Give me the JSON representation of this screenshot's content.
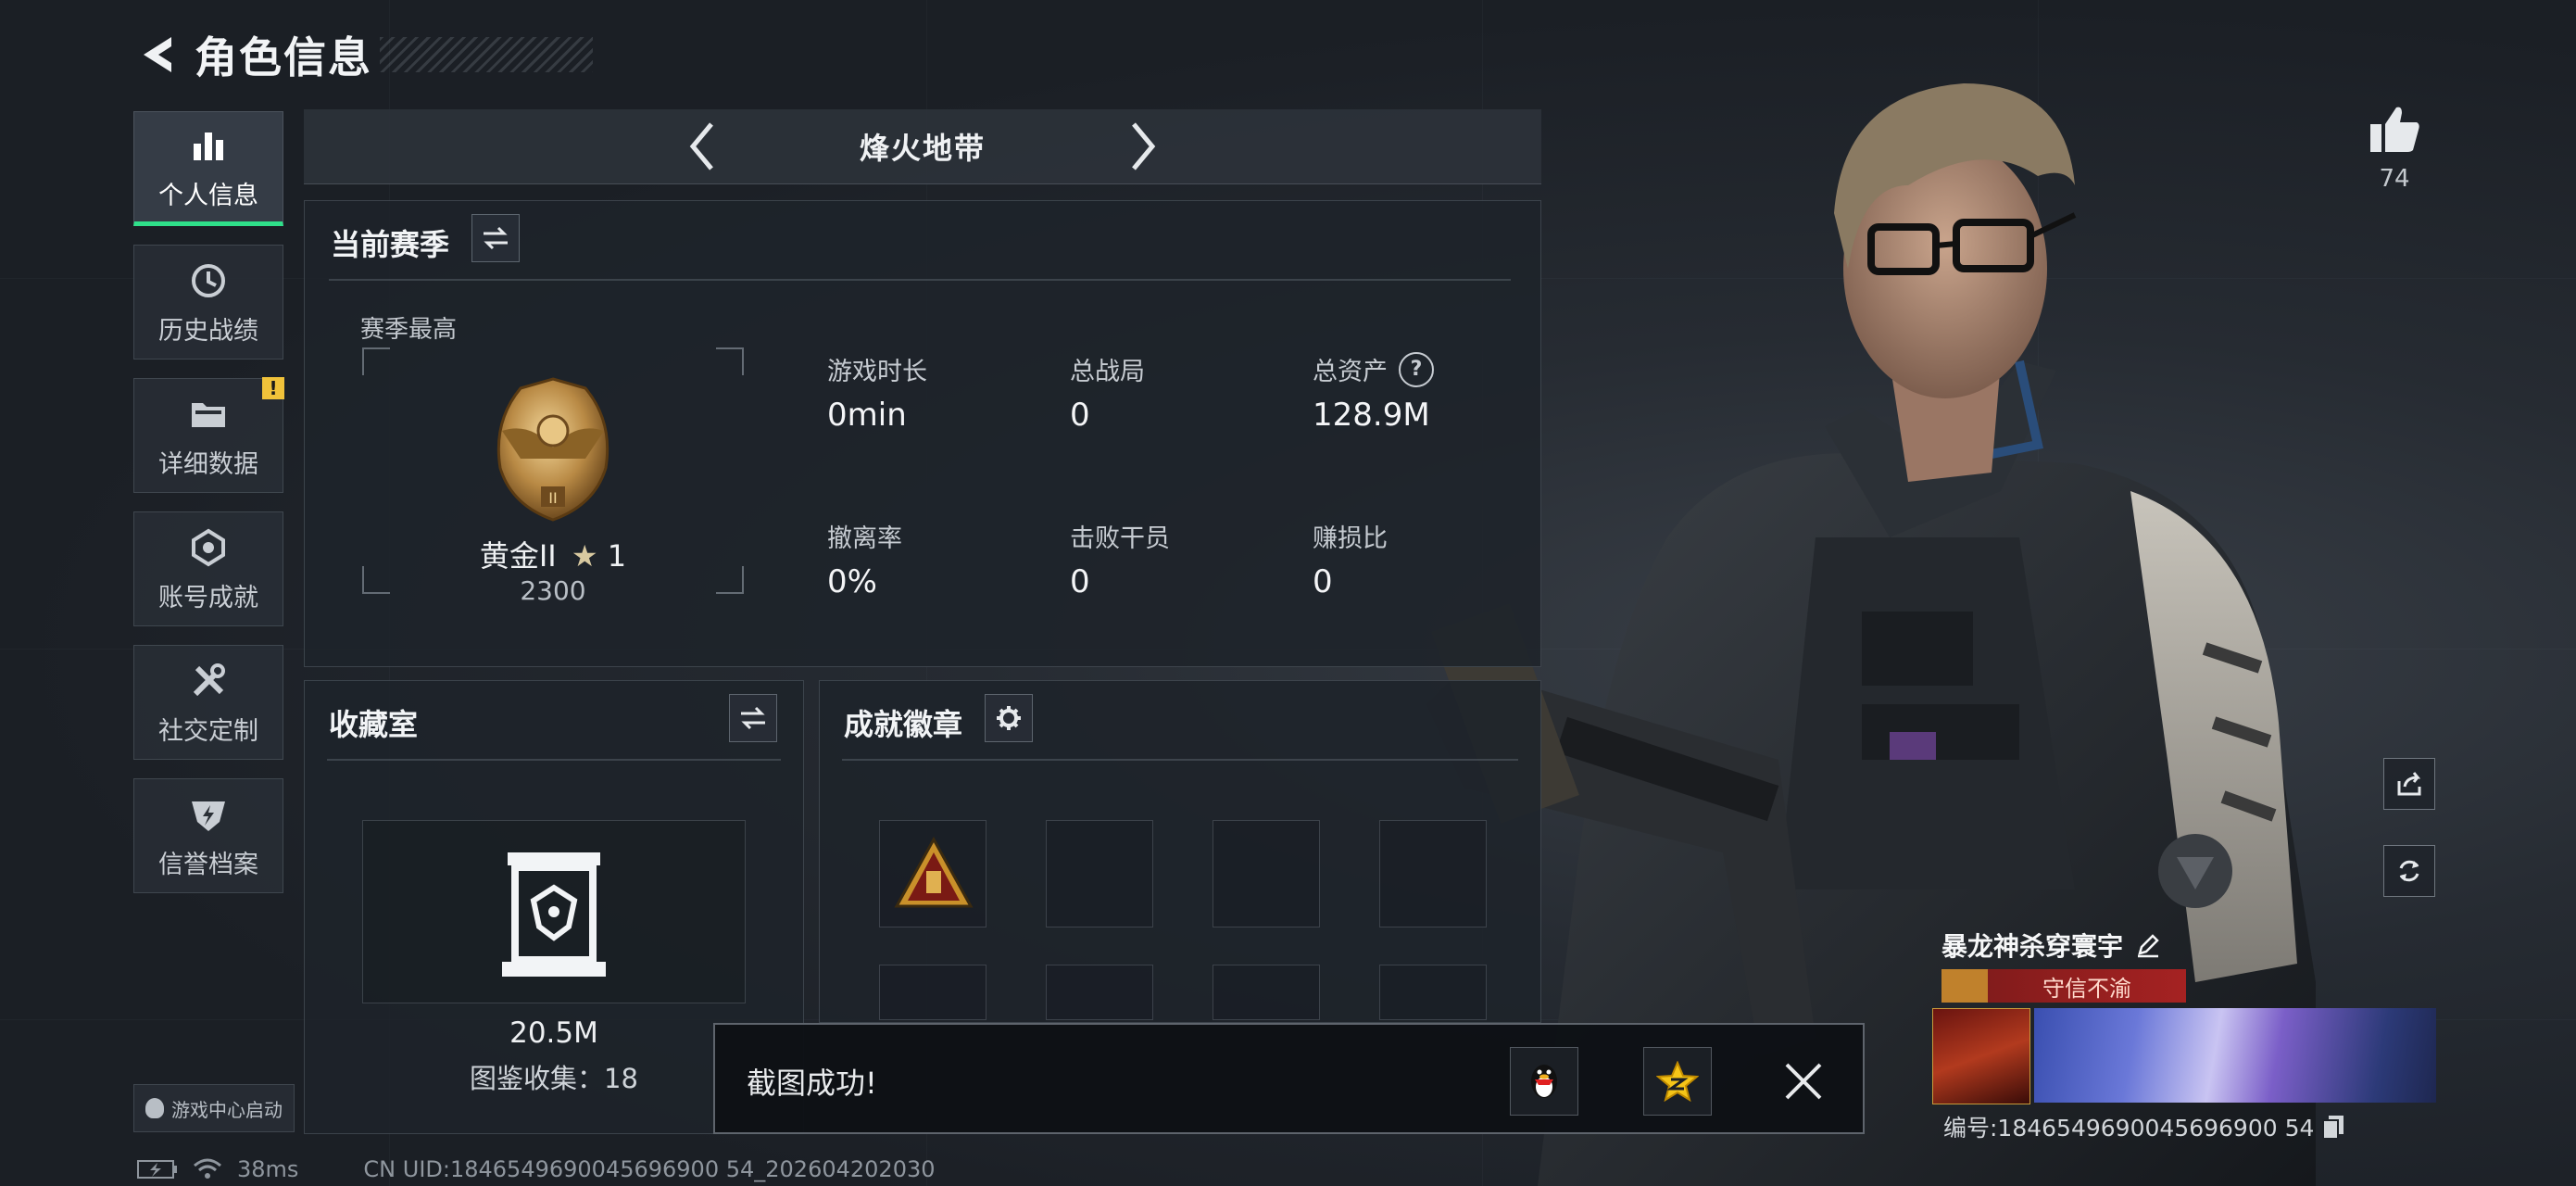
{
  "header": {
    "title": "角色信息"
  },
  "sidebar": {
    "items": [
      {
        "label": "个人信息",
        "icon": "bar-chart-icon",
        "active": true
      },
      {
        "label": "历史战绩",
        "icon": "clock-history-icon"
      },
      {
        "label": "详细数据",
        "icon": "folder-icon",
        "badge": "!"
      },
      {
        "label": "账号成就",
        "icon": "achievement-icon"
      },
      {
        "label": "社交定制",
        "icon": "tools-icon"
      },
      {
        "label": "信誉档案",
        "icon": "shield-lightning-icon"
      }
    ],
    "launch_label": "游戏中心启动"
  },
  "mode": {
    "name": "烽火地带"
  },
  "season": {
    "title": "当前赛季",
    "top_label": "赛季最高",
    "rank_name": "黄金II",
    "rank_star": "1",
    "rank_points": "2300",
    "stats": [
      {
        "label": "游戏时长",
        "value": "0min"
      },
      {
        "label": "总战局",
        "value": "0"
      },
      {
        "label": "总资产",
        "value": "128.9M",
        "help": "?"
      },
      {
        "label": "撤离率",
        "value": "0%"
      },
      {
        "label": "击败干员",
        "value": "0"
      },
      {
        "label": "赚损比",
        "value": "0"
      }
    ]
  },
  "collection": {
    "title": "收藏室",
    "value": "20.5M",
    "count_text": "图鉴收集：18"
  },
  "badges": {
    "title": "成就徽章"
  },
  "toast": {
    "message": "截图成功!"
  },
  "status": {
    "ping": "38ms",
    "uid": "CN UID:1846549690045696900 54_202604202030"
  },
  "likes": {
    "count": "74"
  },
  "player": {
    "name": "暴龙神杀穿寰宇",
    "title_tag": "守信不渝",
    "id_text": "编号:1846549690045696900 54"
  },
  "colors": {
    "accent_green": "#2fe08a",
    "warn_yellow": "#f0c23a",
    "title_red": "#a52222"
  }
}
